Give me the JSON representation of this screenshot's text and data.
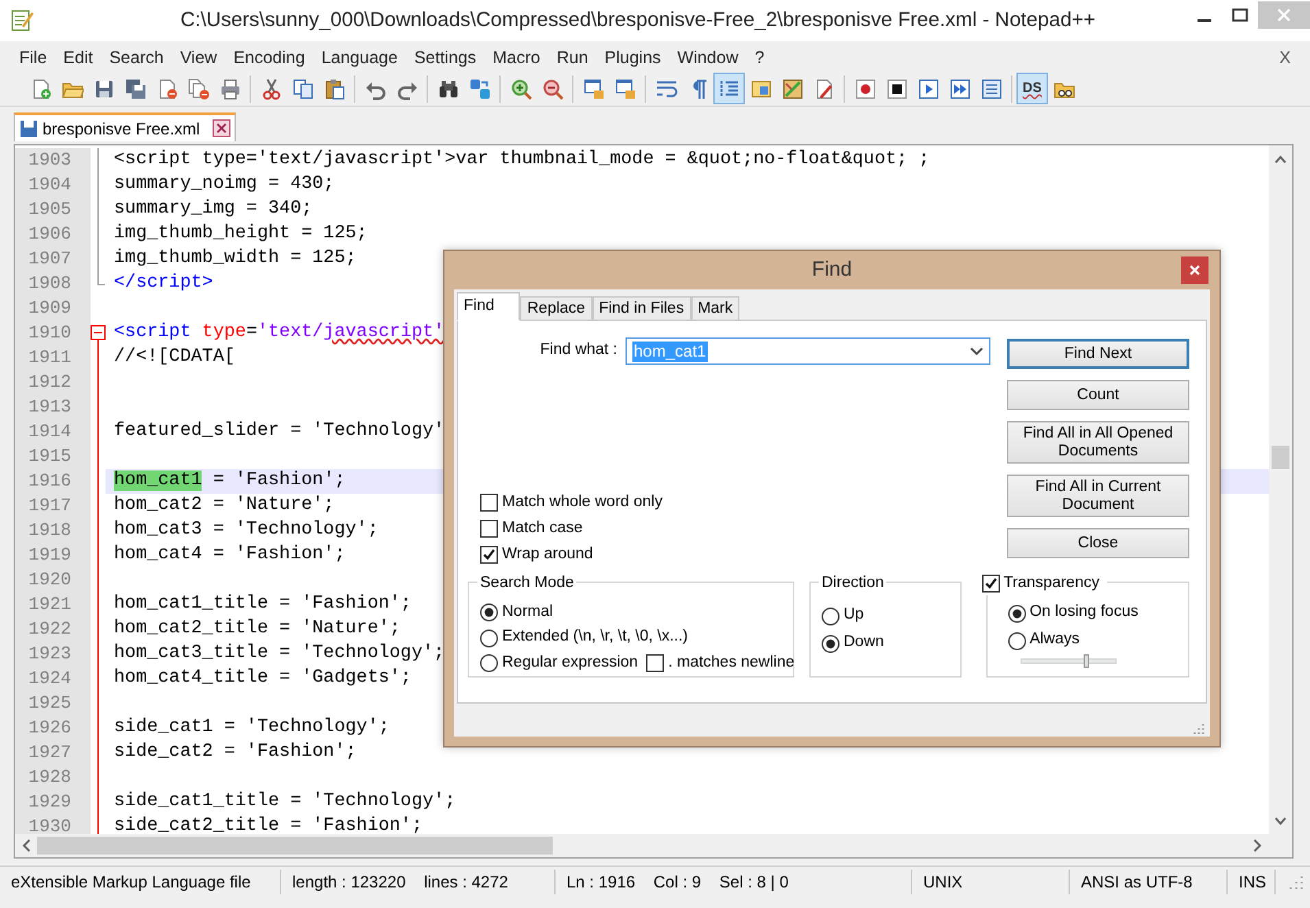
{
  "window": {
    "title": "C:\\Users\\sunny_000\\Downloads\\Compressed\\bresponisve-Free_2\\bresponisve Free.xml - Notepad++"
  },
  "menu": {
    "items": [
      "File",
      "Edit",
      "Search",
      "View",
      "Encoding",
      "Language",
      "Settings",
      "Macro",
      "Run",
      "Plugins",
      "Window",
      "?"
    ],
    "close": "X"
  },
  "toolbar": [
    {
      "buttons": [
        {
          "kind": "new",
          "pressed": false
        },
        {
          "kind": "open",
          "pressed": false
        },
        {
          "kind": "save",
          "pressed": false
        },
        {
          "kind": "saveall",
          "pressed": false
        },
        {
          "kind": "close",
          "pressed": false
        },
        {
          "kind": "closeall",
          "pressed": false
        },
        {
          "kind": "print",
          "pressed": false
        }
      ]
    },
    {
      "buttons": [
        {
          "kind": "cut",
          "pressed": false
        },
        {
          "kind": "copy",
          "pressed": false
        },
        {
          "kind": "paste",
          "pressed": false
        }
      ]
    },
    {
      "buttons": [
        {
          "kind": "undo",
          "pressed": false
        },
        {
          "kind": "redo",
          "pressed": false
        }
      ]
    },
    {
      "buttons": [
        {
          "kind": "find",
          "pressed": false
        },
        {
          "kind": "replace",
          "pressed": false
        }
      ]
    },
    {
      "buttons": [
        {
          "kind": "zoomin",
          "pressed": false
        },
        {
          "kind": "zoomout",
          "pressed": false
        }
      ]
    },
    {
      "buttons": [
        {
          "kind": "syncv",
          "pressed": false
        },
        {
          "kind": "synch",
          "pressed": false
        }
      ]
    },
    {
      "buttons": [
        {
          "kind": "wrap",
          "pressed": false
        },
        {
          "kind": "pilcrow",
          "pressed": false
        },
        {
          "kind": "indent",
          "pressed": true
        },
        {
          "kind": "docmap",
          "pressed": false
        },
        {
          "kind": "map",
          "pressed": false
        },
        {
          "kind": "pen",
          "pressed": false
        }
      ]
    },
    {
      "buttons": [
        {
          "kind": "record",
          "pressed": false
        },
        {
          "kind": "stop",
          "pressed": false
        },
        {
          "kind": "play",
          "pressed": false
        },
        {
          "kind": "playmulti",
          "pressed": false
        },
        {
          "kind": "savemacro",
          "pressed": false
        }
      ]
    },
    {
      "buttons": [
        {
          "kind": "text",
          "label": "DS",
          "pressed": true
        },
        {
          "kind": "folder",
          "pressed": false
        }
      ]
    }
  ],
  "tabs": [
    {
      "label": "bresponisve Free.xml",
      "selected": true
    }
  ],
  "editor": {
    "lines": [
      {
        "number": "1903",
        "kind": "guide",
        "tokens": [
          {
            "kind": "text",
            "text": "<script type='text/javascript'>var thumbnail_mode = &quot;no-float&quot; ;"
          }
        ]
      },
      {
        "number": "1904",
        "kind": "guide",
        "tokens": [
          {
            "kind": "text",
            "text": "summary_noimg = 430;"
          }
        ]
      },
      {
        "number": "1905",
        "kind": "guide",
        "tokens": [
          {
            "kind": "text",
            "text": "summary_img = 340;"
          }
        ]
      },
      {
        "number": "1906",
        "kind": "guide",
        "tokens": [
          {
            "kind": "text",
            "text": "img_thumb_height = 125;"
          }
        ]
      },
      {
        "number": "1907",
        "kind": "guide",
        "tokens": [
          {
            "kind": "text",
            "text": "img_thumb_width = 125;"
          }
        ]
      },
      {
        "number": "1908",
        "kind": "guideend",
        "tokens": [
          {
            "kind": "tag",
            "text": "</script>"
          }
        ]
      },
      {
        "number": "1909",
        "kind": "plain"
      },
      {
        "number": "1910",
        "kind": "foldstart",
        "tokens": [
          {
            "kind": "tag",
            "text": "<script"
          },
          {
            "kind": "attr",
            "text": " type"
          },
          {
            "kind": "text",
            "text": "="
          },
          {
            "kind": "string",
            "text": "'text/"
          },
          {
            "kind": "misspelled",
            "text": "javascript'"
          }
        ]
      },
      {
        "number": "1911",
        "kind": "foldbody",
        "tokens": [
          {
            "kind": "text",
            "text": "//<![CDATA["
          }
        ]
      },
      {
        "number": "1912",
        "kind": "foldbody"
      },
      {
        "number": "1913",
        "kind": "foldbody"
      },
      {
        "number": "1914",
        "kind": "foldbody",
        "tokens": [
          {
            "kind": "text",
            "text": "featured_slider = 'Technology'"
          }
        ]
      },
      {
        "number": "1915",
        "kind": "foldbody"
      },
      {
        "number": "1916",
        "kind": "foldbody",
        "current": true,
        "tokens": [
          {
            "kind": "match",
            "text": "hom_cat1"
          },
          {
            "kind": "text",
            "text": " = 'Fashion';"
          }
        ]
      },
      {
        "number": "1917",
        "kind": "foldbody",
        "tokens": [
          {
            "kind": "text",
            "text": "hom_cat2 = 'Nature';"
          }
        ]
      },
      {
        "number": "1918",
        "kind": "foldbody",
        "tokens": [
          {
            "kind": "text",
            "text": "hom_cat3 = 'Technology';"
          }
        ]
      },
      {
        "number": "1919",
        "kind": "foldbody",
        "tokens": [
          {
            "kind": "text",
            "text": "hom_cat4 = 'Fashion';"
          }
        ]
      },
      {
        "number": "1920",
        "kind": "foldbody"
      },
      {
        "number": "1921",
        "kind": "foldbody",
        "tokens": [
          {
            "kind": "text",
            "text": "hom_cat1_title = 'Fashion';"
          }
        ]
      },
      {
        "number": "1922",
        "kind": "foldbody",
        "tokens": [
          {
            "kind": "text",
            "text": "hom_cat2_title = 'Nature';"
          }
        ]
      },
      {
        "number": "1923",
        "kind": "foldbody",
        "tokens": [
          {
            "kind": "text",
            "text": "hom_cat3_title = 'Technology';"
          }
        ]
      },
      {
        "number": "1924",
        "kind": "foldbody",
        "tokens": [
          {
            "kind": "text",
            "text": "hom_cat4_title = 'Gadgets';"
          }
        ]
      },
      {
        "number": "1925",
        "kind": "foldbody"
      },
      {
        "number": "1926",
        "kind": "foldbody",
        "tokens": [
          {
            "kind": "text",
            "text": "side_cat1 = 'Technology';"
          }
        ]
      },
      {
        "number": "1927",
        "kind": "foldbody",
        "tokens": [
          {
            "kind": "text",
            "text": "side_cat2 = 'Fashion';"
          }
        ]
      },
      {
        "number": "1928",
        "kind": "foldbody"
      },
      {
        "number": "1929",
        "kind": "foldbody",
        "tokens": [
          {
            "kind": "text",
            "text": "side_cat1_title = 'Technology';"
          }
        ]
      },
      {
        "number": "1930",
        "kind": "foldbody",
        "tokens": [
          {
            "kind": "text",
            "text": "side_cat2_title = 'Fashion';"
          }
        ]
      }
    ]
  },
  "find_dialog": {
    "title": "Find",
    "tabs": [
      {
        "label": "Find",
        "selected": true
      },
      {
        "label": "Replace",
        "selected": false
      },
      {
        "label": "Find in Files",
        "selected": false
      },
      {
        "label": "Mark",
        "selected": false
      }
    ],
    "find_what": {
      "label": "Find what :",
      "value": "hom_cat1",
      "value_selected": true
    },
    "options": [
      {
        "label": "Match whole word only",
        "checked": false
      },
      {
        "label": "Match case",
        "checked": false
      },
      {
        "label": "Wrap around",
        "checked": true
      }
    ],
    "buttons": [
      {
        "label": "Find Next",
        "default": true
      },
      {
        "label": "Count",
        "default": false
      },
      {
        "label": "Find All in All Opened Documents",
        "default": false
      },
      {
        "label": "Find All in Current Document",
        "default": false
      },
      {
        "label": "Close",
        "default": false
      }
    ],
    "search_mode": {
      "title": "Search Mode",
      "options": [
        {
          "label": "Normal",
          "selected": true
        },
        {
          "label": "Extended (\\n, \\r, \\t, \\0, \\x...)",
          "selected": false
        },
        {
          "label": "Regular expression",
          "selected": false
        }
      ],
      "dot_matches_newline": {
        "label": ". matches newline",
        "checked": false
      }
    },
    "direction": {
      "title": "Direction",
      "options": [
        {
          "label": "Up",
          "selected": false
        },
        {
          "label": "Down",
          "selected": true
        }
      ]
    },
    "transparency": {
      "label": "Transparency",
      "checked": true,
      "options": [
        {
          "label": "On losing focus",
          "selected": true
        },
        {
          "label": "Always",
          "selected": false
        }
      ],
      "level": 0.7
    }
  },
  "status_bar": [
    "eXtensible Markup Language file",
    "length : 123220    lines : 4272",
    "Ln : 1916    Col : 9    Sel : 8 | 0",
    "UNIX",
    "ANSI as UTF-8",
    "INS"
  ]
}
